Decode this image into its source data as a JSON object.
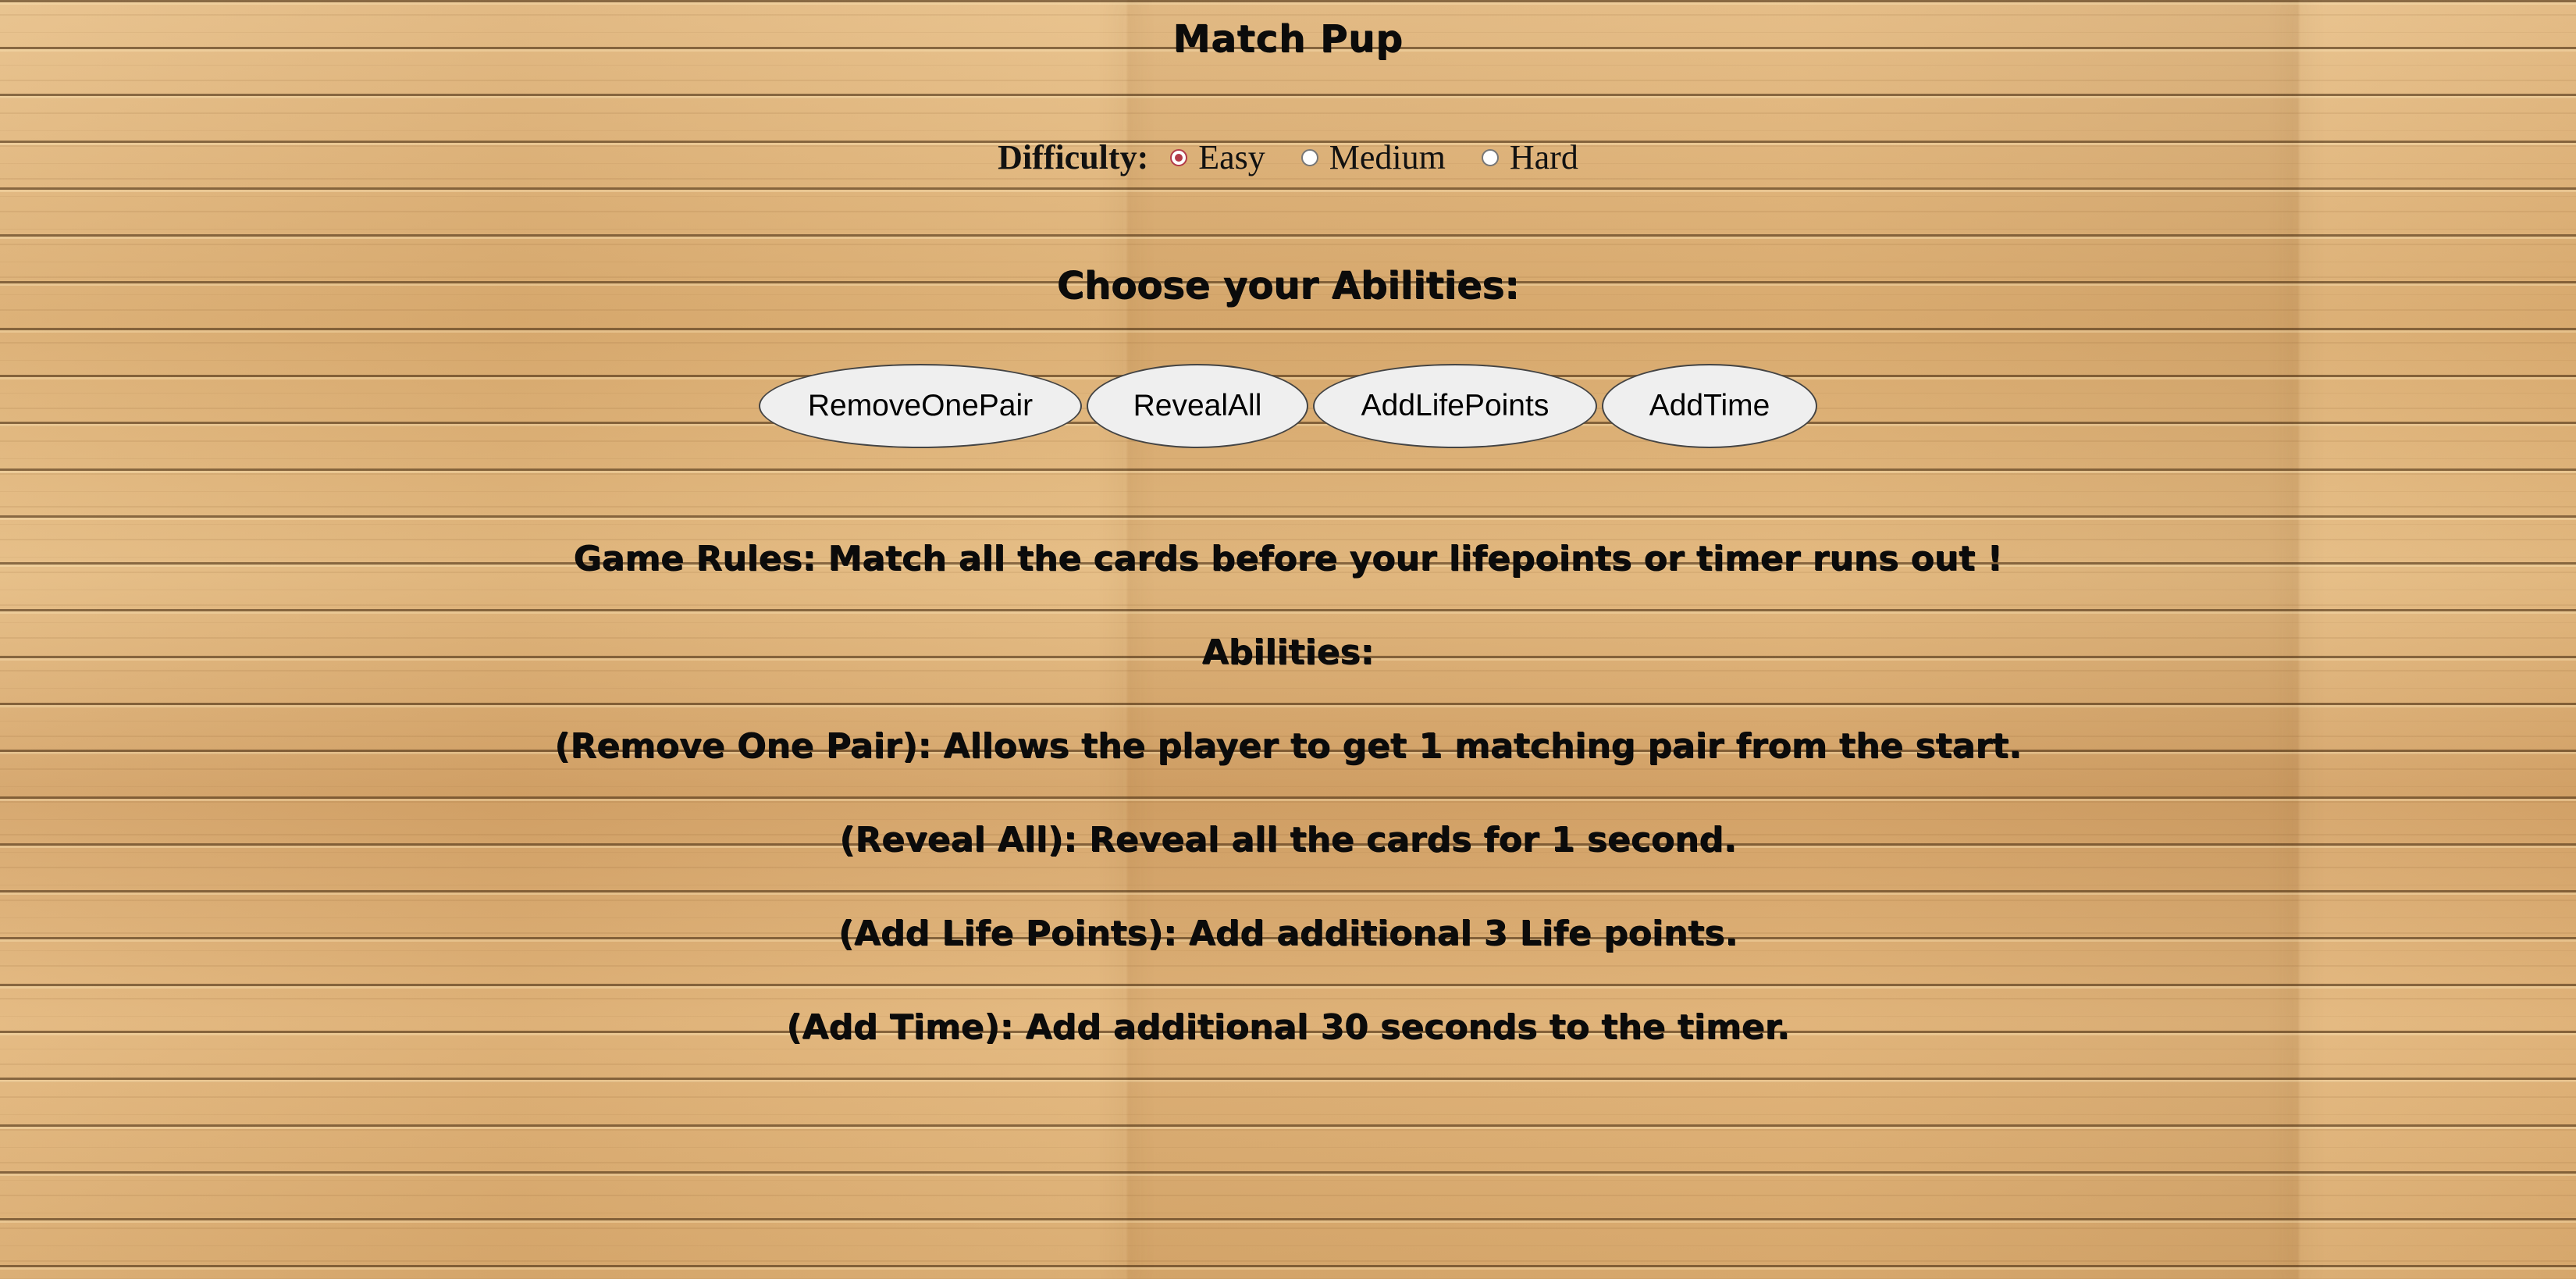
{
  "app": {
    "title": "Match Pup"
  },
  "difficulty": {
    "label": "Difficulty:",
    "options": [
      {
        "label": "Easy",
        "checked": true
      },
      {
        "label": "Medium",
        "checked": false
      },
      {
        "label": "Hard",
        "checked": false
      }
    ]
  },
  "abilities": {
    "heading": "Choose your Abilities:",
    "buttons": [
      {
        "label": "RemoveOnePair"
      },
      {
        "label": "RevealAll"
      },
      {
        "label": "AddLifePoints"
      },
      {
        "label": "AddTime"
      }
    ]
  },
  "rules": {
    "game_rules": "Game Rules: Match all the cards before your lifepoints or timer runs out !",
    "abilities_title": "Abilities:",
    "remove_one_pair": "(Remove One Pair): Allows the player to get 1 matching pair from the start.",
    "reveal_all": "(Reveal All): Reveal all the cards for 1 second.",
    "add_life_points": "(Add Life Points): Add additional 3 Life points.",
    "add_time": "(Add Time): Add additional 30 seconds to the timer."
  },
  "colors": {
    "radio_checked": "#b23a48",
    "button_bg": "#efefef",
    "wood": "#d9b07a"
  }
}
